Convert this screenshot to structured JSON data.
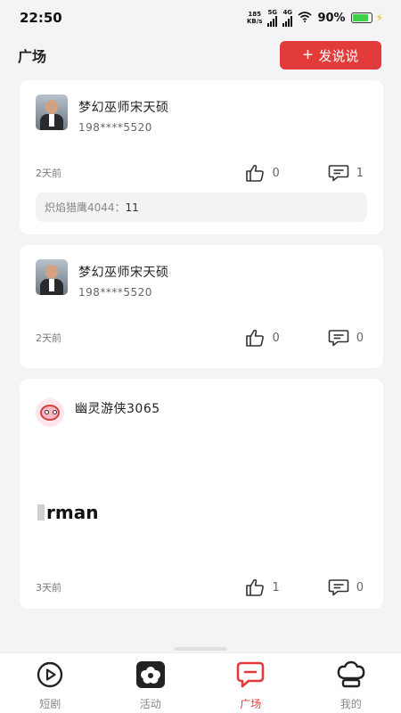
{
  "status_bar": {
    "time": "22:50",
    "net_speed_top": "185",
    "net_speed_bottom": "KB/s",
    "net_type_1": "5G",
    "net_type_2": "4G",
    "battery_pct": "90%"
  },
  "header": {
    "title": "广场",
    "post_button_icon": "+",
    "post_button_label": "发说说"
  },
  "posts": [
    {
      "avatar": "user-photo-avatar",
      "name": "梦幻巫师宋天硕",
      "phone": "198****5520",
      "time": "2天前",
      "likes": "0",
      "comments": "1",
      "comment_preview": {
        "user": "炽焰猎鹰4044：",
        "text": "11"
      }
    },
    {
      "avatar": "user-photo-avatar",
      "name": "梦幻巫师宋天硕",
      "phone": "198****5520",
      "time": "2天前",
      "likes": "0",
      "comments": "0"
    },
    {
      "avatar": "cartoon-avatar",
      "name": "幽灵游侠3065",
      "content": "rman",
      "time": "3天前",
      "likes": "1",
      "comments": "0"
    }
  ],
  "tabs": [
    {
      "label": "短剧",
      "icon": "play-circle-icon",
      "active": false
    },
    {
      "label": "活动",
      "icon": "flower-icon",
      "active": false
    },
    {
      "label": "广场",
      "icon": "chat-bubble-icon",
      "active": true
    },
    {
      "label": "我的",
      "icon": "chef-hat-icon",
      "active": false
    }
  ],
  "colors": {
    "accent": "#e33a3a",
    "background": "#f4f4f6",
    "battery": "#3ed14a"
  }
}
